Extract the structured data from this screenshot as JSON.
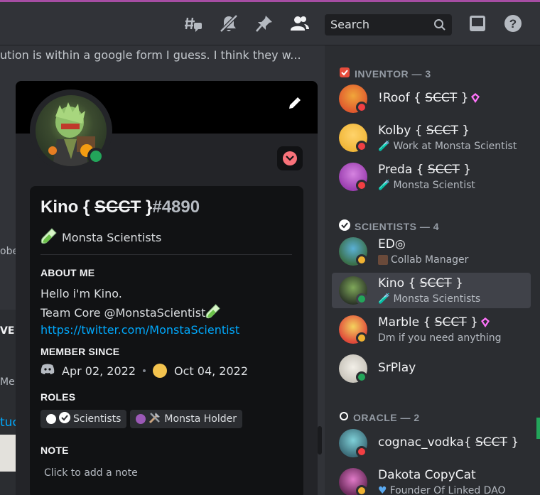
{
  "topbar": {
    "search_placeholder": "Search",
    "icons": [
      "threads-icon",
      "mute-bell-icon",
      "pin-icon",
      "member-list-icon",
      "search-icon",
      "inbox-icon",
      "help-icon"
    ]
  },
  "chat": {
    "visible_line": "ution is within a google form I guess. I think they w...",
    "cut_labels": [
      "obe",
      "VE",
      "Mer",
      "tuc"
    ]
  },
  "profile": {
    "username": "Kino { ",
    "username_strike": "SCCT",
    "username_close": " }",
    "discriminator": "#4890",
    "custom_status": "Monsta Scientists",
    "about_title": "ABOUT ME",
    "about_line1": "Hello i'm Kino.",
    "about_line2": "Team Core @MonstaScientist",
    "about_link": "https://twitter.com/MonstaScientist",
    "member_since_title": "MEMBER SINCE",
    "discord_since": "Apr 02, 2022",
    "server_since": "Oct 04, 2022",
    "roles_title": "ROLES",
    "roles": [
      {
        "label": "Scientists",
        "color": "#ffffff"
      },
      {
        "label": "Monsta Holder",
        "color": "#9b59b6"
      }
    ],
    "note_title": "NOTE",
    "note_placeholder": "Click to add a note",
    "colors": {
      "status_online": "#23a55a",
      "nitro": "#f9727a"
    }
  },
  "members": {
    "groups": [
      {
        "title": "INVENTOR — 3"
      },
      {
        "title": "SCIENTISTS — 4"
      },
      {
        "title": "ORACLE — 2"
      }
    ],
    "items": [
      {
        "name": "!Roof { ",
        "strike": "SCCT",
        "close": " }",
        "sub": "",
        "status": "dnd"
      },
      {
        "name": "Kolby { ",
        "strike": "SCCT",
        "close": " }",
        "sub": "Work at Monsta Scientist",
        "status": "dnd"
      },
      {
        "name": "Preda { ",
        "strike": "SCCT",
        "close": " }",
        "sub": "Monsta Scientist",
        "status": "dnd"
      },
      {
        "name": "ED◎",
        "strike": "",
        "close": "",
        "sub": "Collab Manager",
        "status": "idle"
      },
      {
        "name": "Kino { ",
        "strike": "SCCT",
        "close": " }",
        "sub": "Monsta Scientists",
        "status": "online"
      },
      {
        "name": "Marble { ",
        "strike": "SCCT",
        "close": " }",
        "sub": "Dm if you need anything",
        "status": "idle"
      },
      {
        "name": "SrPlay",
        "strike": "",
        "close": "",
        "sub": "",
        "status": "online"
      },
      {
        "name": "cognac_vodka{ ",
        "strike": "SCCT",
        "close": " }",
        "sub": "",
        "status": "dnd"
      },
      {
        "name": "Dakota CopyCat",
        "strike": "",
        "close": "",
        "sub": "Founder Of Linked DAO",
        "status": "idle"
      }
    ]
  }
}
